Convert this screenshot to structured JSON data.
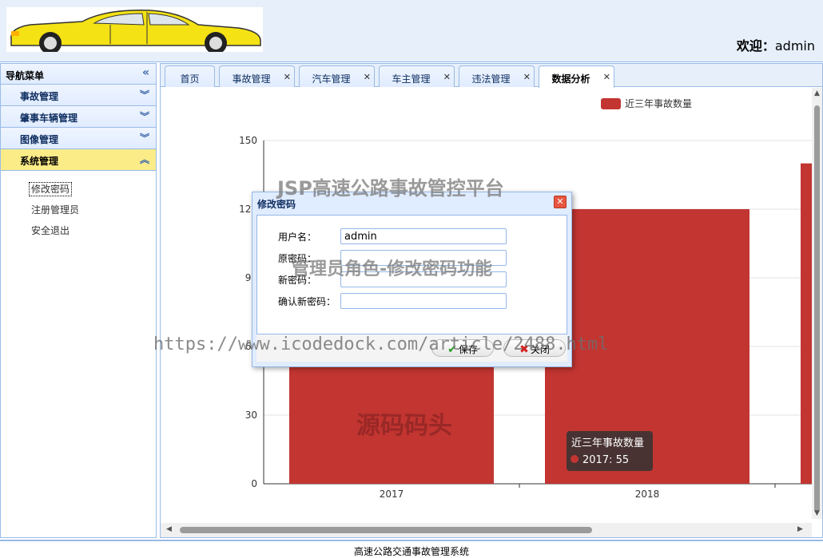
{
  "header": {
    "welcome_label": "欢迎：",
    "username": "admin"
  },
  "sidebar": {
    "title": "导航菜单",
    "sections": [
      {
        "label": "事故管理"
      },
      {
        "label": "肇事车辆管理"
      },
      {
        "label": "图像管理"
      },
      {
        "label": "系统管理"
      }
    ],
    "sub_items": [
      {
        "label": "修改密码"
      },
      {
        "label": "注册管理员"
      },
      {
        "label": "安全退出"
      }
    ]
  },
  "tabs": [
    {
      "label": "首页"
    },
    {
      "label": "事故管理"
    },
    {
      "label": "汽车管理"
    },
    {
      "label": "车主管理"
    },
    {
      "label": "违法管理"
    },
    {
      "label": "数据分析"
    }
  ],
  "chart_data": {
    "type": "bar",
    "categories": [
      "2017",
      "2018"
    ],
    "series": [
      {
        "name": "近三年事故数量",
        "values": [
          55,
          120,
          140
        ]
      }
    ],
    "y_ticks": [
      "0",
      "30",
      "60",
      "90",
      "120",
      "150"
    ],
    "ylim": [
      0,
      150
    ],
    "legend_position": "top-right",
    "color": "#c23531",
    "tooltip": {
      "title": "近三年事故数量",
      "text": "2017: 55"
    }
  },
  "dialog": {
    "title": "修改密码",
    "fields": [
      {
        "label": "用户名：",
        "value": "admin"
      },
      {
        "label": "原密码：",
        "value": ""
      },
      {
        "label": "新密码：",
        "value": ""
      },
      {
        "label": "确认新密码：",
        "value": ""
      }
    ],
    "save_label": "保存",
    "close_label": "关闭"
  },
  "watermarks": {
    "title": "JSP高速公路事故管控平台",
    "subtitle": "管理员角色-修改密码功能",
    "url": "https://www.icodedock.com/article/2488.html",
    "brand": "源码码头"
  },
  "footer": {
    "text": "高速公路交通事故管理系统"
  }
}
